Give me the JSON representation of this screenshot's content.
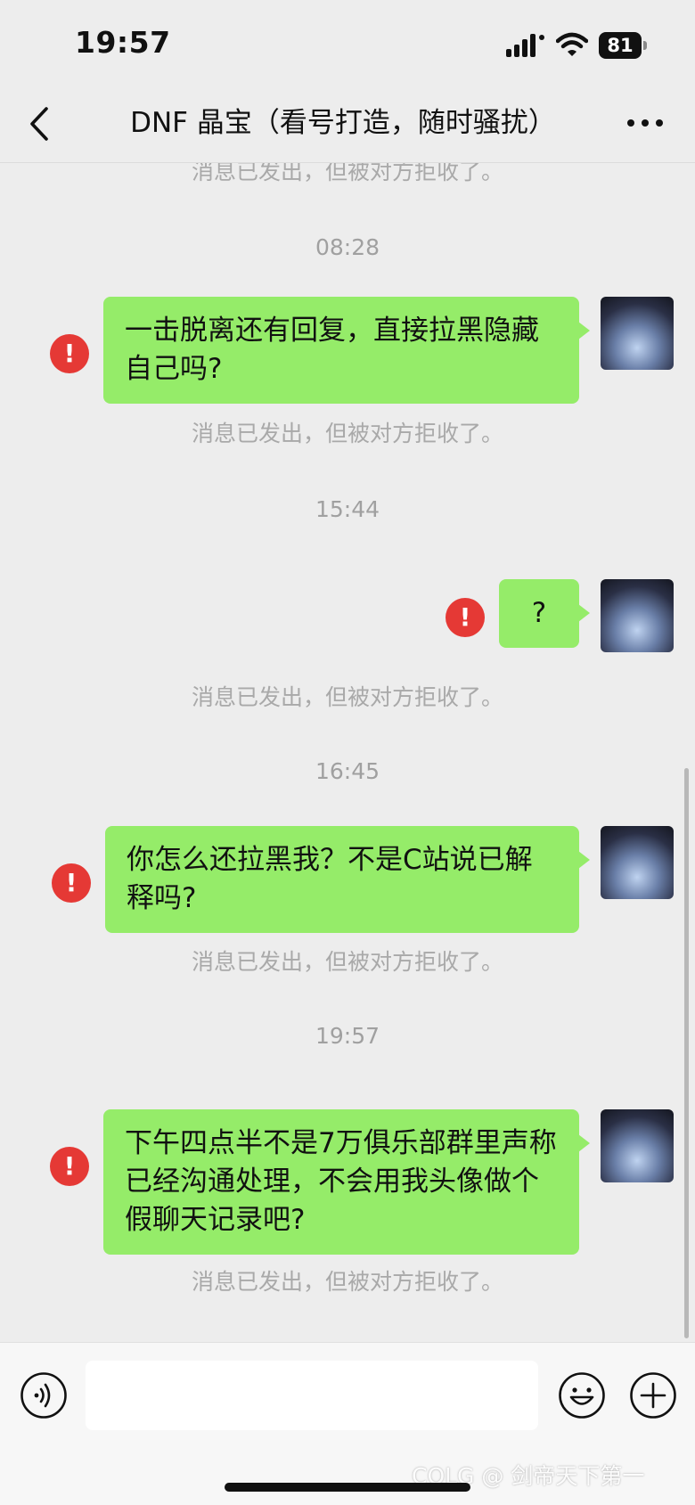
{
  "status_bar": {
    "time": "19:57",
    "battery": "81"
  },
  "header": {
    "title": "DNF 晶宝（看号打造，随时骚扰）"
  },
  "error_icon_glyph": "!",
  "messages": [
    {
      "kind": "notice",
      "text": "消息已发出，但被对方拒收了。"
    },
    {
      "kind": "time",
      "text": "08:28"
    },
    {
      "kind": "sent",
      "text": "一击脱离还有回复，直接拉黑隐藏自己吗?",
      "failed": true
    },
    {
      "kind": "notice",
      "text": "消息已发出，但被对方拒收了。"
    },
    {
      "kind": "time",
      "text": "15:44"
    },
    {
      "kind": "sent",
      "text": "?",
      "failed": true
    },
    {
      "kind": "notice",
      "text": "消息已发出，但被对方拒收了。"
    },
    {
      "kind": "time",
      "text": "16:45"
    },
    {
      "kind": "sent",
      "text": "你怎么还拉黑我？不是C站说已解释吗?",
      "failed": true
    },
    {
      "kind": "notice",
      "text": "消息已发出，但被对方拒收了。"
    },
    {
      "kind": "time",
      "text": "19:57"
    },
    {
      "kind": "sent",
      "text": "下午四点半不是7万俱乐部群里声称已经沟通处理，不会用我头像做个假聊天记录吧?",
      "failed": true
    },
    {
      "kind": "notice",
      "text": "消息已发出，但被对方拒收了。"
    }
  ],
  "input_bar": {
    "placeholder": ""
  },
  "watermark": "COLG @ 剑帝天下第一",
  "icons": {
    "back": "chevron-left-icon",
    "more": "more-dots-icon",
    "voice": "voice-icon",
    "emoji": "emoji-icon",
    "plus": "plus-icon",
    "error": "error-icon"
  },
  "colors": {
    "bubble": "#95ec69",
    "error": "#e53935",
    "background": "#ededed"
  }
}
